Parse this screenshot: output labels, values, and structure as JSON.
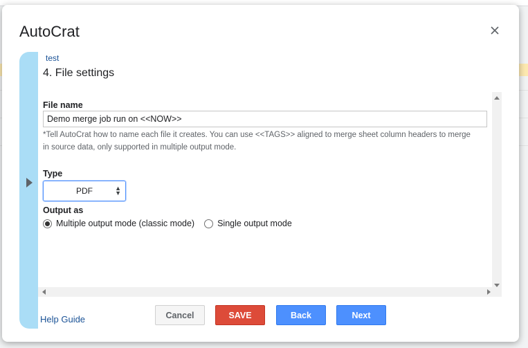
{
  "dialog": {
    "title": "AutoCrat",
    "job_name": "test",
    "step_title": "4. File settings"
  },
  "file_name": {
    "label": "File name",
    "value": "Demo merge job run on <<NOW>>",
    "hint": "*Tell AutoCrat how to name each file it creates. You can use <<TAGS>> aligned to merge sheet column headers to merge in source data, only supported in multiple output mode."
  },
  "type": {
    "label": "Type",
    "selected": "PDF"
  },
  "output": {
    "label": "Output as",
    "options": [
      {
        "label": "Multiple output mode (classic mode)",
        "checked": true
      },
      {
        "label": "Single output mode",
        "checked": false
      }
    ]
  },
  "footer": {
    "help_link": "Help Guide",
    "cancel": "Cancel",
    "save": "SAVE",
    "back": "Back",
    "next": "Next"
  },
  "colors": {
    "side_bar": "#aaddf6",
    "save": "#dd4b39",
    "primary": "#4d90fe",
    "link": "#1a5296"
  },
  "icons": {
    "close": "close-icon",
    "side_arrow": "expand-arrow-icon"
  }
}
